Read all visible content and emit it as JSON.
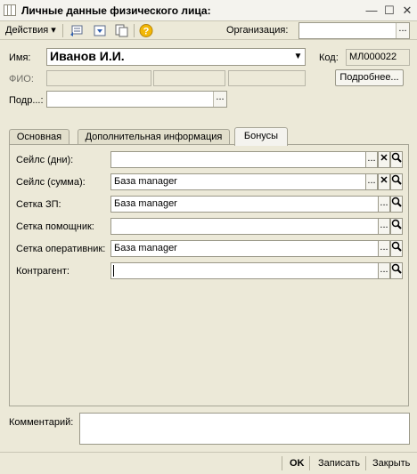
{
  "window": {
    "title": "Личные данные физического лица:"
  },
  "toolbar": {
    "actions_label": "Действия",
    "org_label": "Организация:",
    "org_value": ""
  },
  "fields": {
    "name_label": "Имя:",
    "name_value": "Иванов И.И.",
    "code_label": "Код:",
    "code_value": "МЛ000022",
    "fio_label": "ФИО:",
    "details_button": "Подробнее...",
    "dept_label": "Подр...:",
    "dept_value": ""
  },
  "tabs": [
    {
      "label": "Основная"
    },
    {
      "label": "Дополнительная информация"
    },
    {
      "label": "Бонусы"
    }
  ],
  "bonus_rows": [
    {
      "label": "Сейлс (дни):",
      "value": ""
    },
    {
      "label": "Сейлс (сумма):",
      "value": "База manager"
    },
    {
      "label": "Сетка ЗП:",
      "value": "База manager"
    },
    {
      "label": "Сетка помощник:",
      "value": ""
    },
    {
      "label": "Сетка оперативник:",
      "value": "База manager"
    },
    {
      "label": "Контрагент:",
      "value": ""
    }
  ],
  "comment": {
    "label": "Комментарий:",
    "value": ""
  },
  "footer": {
    "ok": "OK",
    "save": "Записать",
    "close": "Закрыть"
  },
  "icons": {
    "dots": "...",
    "clear": "✕",
    "search": "🔍",
    "help": "?",
    "minimize": "—",
    "maximize": "☐",
    "close": "✕"
  }
}
